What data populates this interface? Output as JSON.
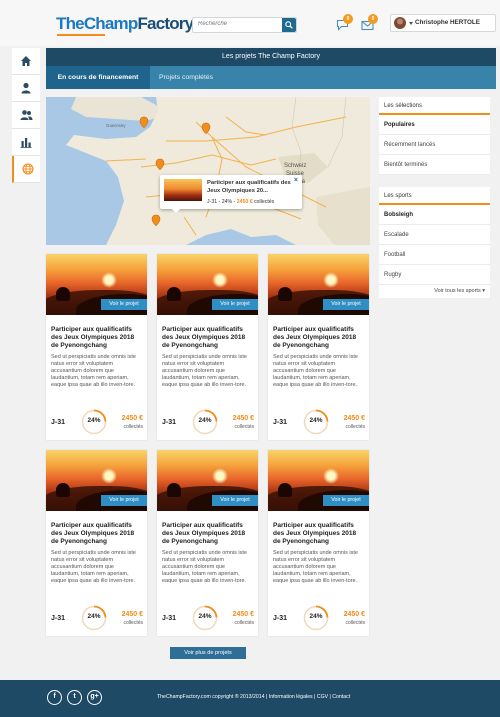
{
  "header": {
    "logo_part1": "TheChamp",
    "logo_part2": "Factory",
    "search_placeholder": "Recherche",
    "messages_count": "0",
    "notifications_count": "0",
    "username": "Christophe HERTOLE"
  },
  "nav": {
    "items": [
      "home-icon",
      "profile-icon",
      "community-icon",
      "stats-icon",
      "globe-icon"
    ]
  },
  "titlebar": "Les projets The Champ Factory",
  "tabs": [
    {
      "label": "En cours de financement",
      "active": true
    },
    {
      "label": "Projets complétés",
      "active": false
    }
  ],
  "map": {
    "popup": {
      "title": "Participer aux qualificatifs des Jeux Olympiques 20...",
      "days": "J-31",
      "percent": "24%",
      "amount": "2450 €",
      "collected": "collectés",
      "close": "×"
    }
  },
  "sidebar": {
    "selections_title": "Les sélections",
    "selections": [
      "Populaires",
      "Récemment lancés",
      "Bientôt terminés"
    ],
    "sports_title": "Les sports",
    "sports": [
      "Bobsleigh",
      "Escalade",
      "Football",
      "Rugby"
    ],
    "see_all": "Voir tous les sports"
  },
  "cards": [
    {
      "view": "Voir le projet",
      "title": "Participer aux qualificatifs des Jeux Olympiques 2018 de Pyenongchang",
      "desc": "Sed ut perspiciatis unde omnis iste natus error sit voluptatem accusantium dolorem que laudantium, totam rem aperiam, eaque ipsa quae ab illo inven-tore.",
      "days": "J-31",
      "percent": 24,
      "percent_label": "24%",
      "amount": "2450 €",
      "collected": "collectés"
    },
    {
      "view": "Voir le projet",
      "title": "Participer aux qualificatifs des Jeux Olympiques 2018 de Pyenongchang",
      "desc": "Sed ut perspiciatis unde omnis iste natus error sit voluptatem accusantium dolorem que laudantium, totam rem aperiam, eaque ipsa quae ab illo inven-tore.",
      "days": "J-31",
      "percent": 24,
      "percent_label": "24%",
      "amount": "2450 €",
      "collected": "collectés"
    },
    {
      "view": "Voir le projet",
      "title": "Participer aux qualificatifs des Jeux Olympiques 2018 de Pyenongchang",
      "desc": "Sed ut perspiciatis unde omnis iste natus error sit voluptatem accusantium dolorem que laudantium, totam rem aperiam, eaque ipsa quae ab illo inven-tore.",
      "days": "J-31",
      "percent": 24,
      "percent_label": "24%",
      "amount": "2450 €",
      "collected": "collectés"
    },
    {
      "view": "Voir le projet",
      "title": "Participer aux qualificatifs des Jeux Olympiques 2018 de Pyenongchang",
      "desc": "Sed ut perspiciatis unde omnis iste natus error sit voluptatem accusantium dolorem que laudantium, totam rem aperiam, eaque ipsa quae ab illo inven-tore.",
      "days": "J-31",
      "percent": 24,
      "percent_label": "24%",
      "amount": "2450 €",
      "collected": "collectés"
    },
    {
      "view": "Voir le projet",
      "title": "Participer aux qualificatifs des Jeux Olympiques 2018 de Pyenongchang",
      "desc": "Sed ut perspiciatis unde omnis iste natus error sit voluptatem accusantium dolorem que laudantium, totam rem aperiam, eaque ipsa quae ab illo inven-tore.",
      "days": "J-31",
      "percent": 24,
      "percent_label": "24%",
      "amount": "2450 €",
      "collected": "collectés"
    },
    {
      "view": "Voir le projet",
      "title": "Participer aux qualificatifs des Jeux Olympiques 2018 de Pyenongchang",
      "desc": "Sed ut perspiciatis unde omnis iste natus error sit voluptatem accusantium dolorem que laudantium, totam rem aperiam, eaque ipsa quae ab illo inven-tore.",
      "days": "J-31",
      "percent": 24,
      "percent_label": "24%",
      "amount": "2450 €",
      "collected": "collectés"
    }
  ],
  "more_button": "Voir plus de projets",
  "footer": {
    "social": [
      "facebook-icon",
      "twitter-icon",
      "googleplus-icon"
    ],
    "text": "TheChampFactory.com copyright ® 2013/2014  |  Information légales  |  CGV  |  Contact"
  },
  "colors": {
    "brand_blue": "#1b7ac1",
    "navy": "#1f4a66",
    "tab_blue": "#3783a9",
    "accent_orange": "#f28c1a",
    "button_blue": "#2f8ec4"
  }
}
